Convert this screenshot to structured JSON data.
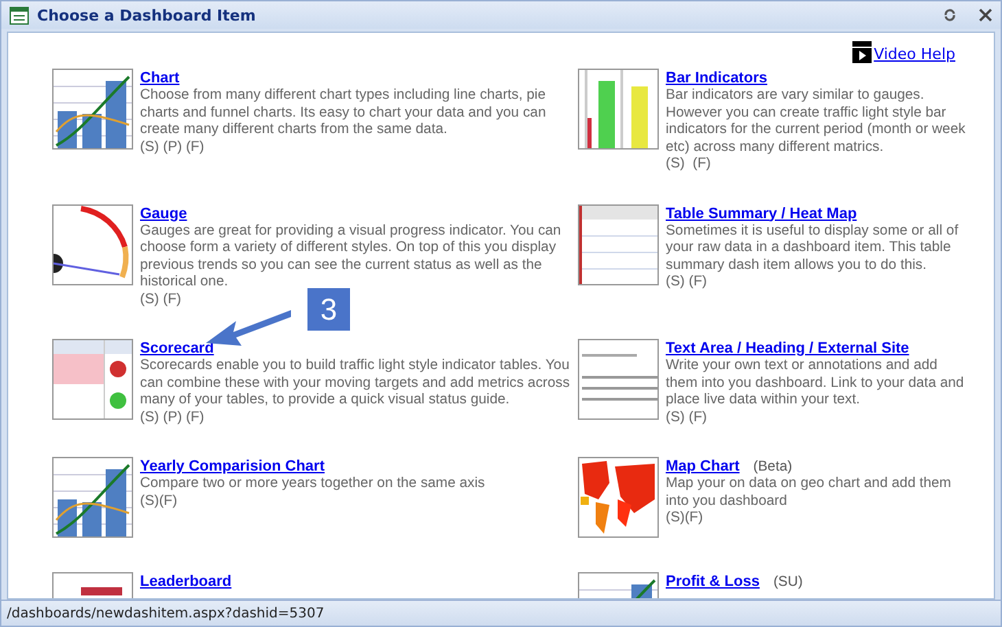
{
  "window": {
    "title": "Choose a Dashboard Item"
  },
  "help_link": "Video Help",
  "items": [
    {
      "kind": "chart",
      "title": "Chart",
      "description": "Choose from many different chart types including line charts, pie charts and funnel charts. Its easy to chart your data and you can create many different charts from the same data.",
      "flags": "(S) (P) (F)"
    },
    {
      "kind": "bars",
      "title": "Bar Indicators",
      "description": "Bar indicators are vary similar to gauges. However you can create traffic light style bar indicators for the current period (month or week etc) across many different matrics.",
      "flags": "(S)  (F)"
    },
    {
      "kind": "gauge",
      "title": "Gauge",
      "description": "Gauges are great for providing a visual progress indicator. You can choose form a variety of different styles. On top of this you display previous trends so you can see the current status as well as the historical one.",
      "flags": "(S) (F)"
    },
    {
      "kind": "table",
      "title": "Table Summary / Heat Map",
      "description": "Sometimes it is useful to display some or all of your raw data in a dashboard item. This table summary dash item allows you to do this.",
      "flags": "(S) (F)"
    },
    {
      "kind": "scorecard",
      "title": "Scorecard",
      "description": "Scorecards enable you to build traffic light style indicator tables. You can combine these with your moving targets and add metrics across many of your tables, to provide a quick visual status guide.",
      "flags": "(S) (P) (F)"
    },
    {
      "kind": "text",
      "title": "Text Area / Heading / External Site",
      "description": "Write your own text or annotations and add them into you dashboard. Link to your data and place live data within your text.",
      "flags": "(S) (F)"
    },
    {
      "kind": "chart",
      "title": "Yearly Comparision Chart",
      "description": "Compare two or more years together on the same axis",
      "flags": "(S)(F)"
    },
    {
      "kind": "map",
      "title": "Map Chart",
      "tag": "(Beta)",
      "description": "Map your on data on geo chart and add them into you dashboard",
      "flags": "(S)(F)"
    },
    {
      "kind": "leader",
      "title": "Leaderboard"
    },
    {
      "kind": "chart",
      "title": "Profit & Loss",
      "tag": "(SU)"
    }
  ],
  "callout": {
    "label": "3"
  },
  "status_bar": "/dashboards/newdashitem.aspx?dashid=5307"
}
